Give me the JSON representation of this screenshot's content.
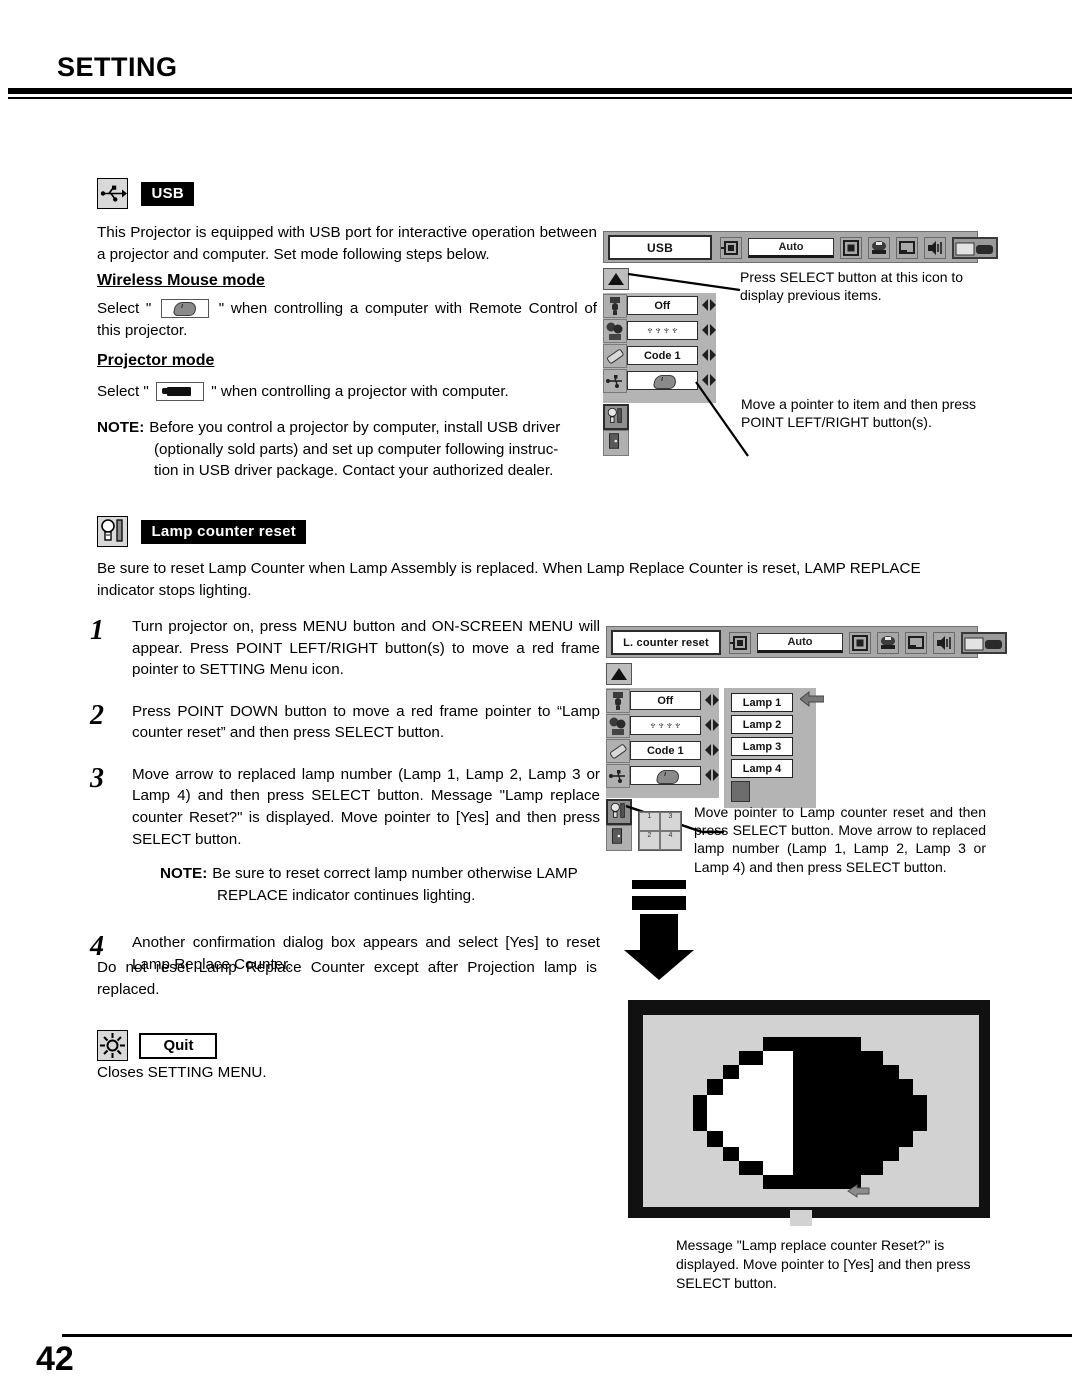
{
  "header": {
    "title": "SETTING"
  },
  "usb_section": {
    "icon_name": "usb-icon",
    "label": "USB",
    "intro": "This Projector is equipped with USB port for interactive operation between a projector and computer. Set mode following steps below.",
    "wireless_mouse": {
      "heading": "Wireless Mouse mode",
      "text_before": "Select \"",
      "text_after": "\" when controlling a computer with Remote Control of this projector."
    },
    "projector_mode": {
      "heading": "Projector mode",
      "text_before": "Select \"",
      "text_after": "\" when controlling a projector with computer."
    },
    "note": {
      "label": "NOTE:",
      "line1": "Before you control a projector by computer, install USB driver",
      "line2": "(optionally sold parts) and set up computer following instruc-",
      "line3": "tion in USB driver package. Contact your authorized dealer."
    }
  },
  "usb_osd": {
    "title": "USB",
    "auto_label": "Auto",
    "menu_icons": [
      "input-icon",
      "auto-button",
      "screen-icon",
      "pc-adjust-icon",
      "image-icon",
      "sound-icon",
      "setting-icon"
    ],
    "rows": [
      {
        "icon": "power-management-icon",
        "value": "Off"
      },
      {
        "icon": "lamp-mode-icon",
        "value": "♆♆♆♆"
      },
      {
        "icon": "remote-code-icon",
        "value": "Code 1"
      },
      {
        "icon": "usb-row-icon",
        "value": ""
      }
    ],
    "side_icons": [
      "lamp-counter-reset-icon",
      "quit-icon"
    ],
    "annotation_top": "Press SELECT button at this icon to display previous items.",
    "annotation_bottom": "Move a pointer to item and then press POINT LEFT/RIGHT button(s)."
  },
  "lamp_section": {
    "icon_name": "lamp-counter-reset-icon",
    "label": "Lamp counter reset",
    "intro": "Be sure to reset Lamp Counter when Lamp Assembly is replaced.  When Lamp Replace Counter is reset, LAMP REPLACE indicator stops lighting.",
    "steps": [
      {
        "number": "1",
        "text": "Turn projector on, press MENU button and ON-SCREEN MENU will appear.  Press POINT LEFT/RIGHT button(s) to move a red frame pointer to SETTING Menu icon."
      },
      {
        "number": "2",
        "text": "Press POINT DOWN button to move a red frame pointer to “Lamp counter reset” and then press SELECT button."
      },
      {
        "number": "3",
        "text": "Move arrow to replaced lamp number (Lamp 1, Lamp 2, Lamp 3 or Lamp 4) and then press SELECT button.  Message \"Lamp replace counter Reset?\" is displayed. Move pointer to [Yes] and then press SELECT button.",
        "note_label": "NOTE:",
        "note_line1": "Be sure to reset correct lamp number otherwise LAMP",
        "note_line2": "REPLACE indicator continues lighting."
      },
      {
        "number": "4",
        "text": "Another confirmation dialog box appears and select [Yes] to reset Lamp Replace Counter."
      }
    ],
    "tail": "Do not reset Lamp Replace Counter except after Projection lamp is replaced."
  },
  "lamp_osd": {
    "title": "L. counter reset",
    "auto_label": "Auto",
    "rows": [
      {
        "icon": "power-management-icon",
        "value": "Off"
      },
      {
        "icon": "lamp-mode-icon",
        "value": "♆♆♆♆"
      },
      {
        "icon": "remote-code-icon",
        "value": "Code 1"
      },
      {
        "icon": "usb-row-icon",
        "value": ""
      }
    ],
    "lamp_items": [
      "Lamp 1",
      "Lamp 2",
      "Lamp 3",
      "Lamp 4"
    ],
    "annotation": "Move pointer to Lamp counter reset and then press SELECT button.  Move arrow to replaced lamp number (Lamp 1, Lamp 2, Lamp 3 or Lamp 4) and then press SELECT button."
  },
  "quit_section": {
    "icon_name": "quit-setting-icon",
    "label": "Quit",
    "text": "Closes SETTING MENU."
  },
  "dialog_mock": {
    "annotation": "Message \"Lamp replace counter Reset?\" is displayed. Move pointer to [Yes] and then press SELECT button."
  },
  "footer": {
    "page_number": "42"
  }
}
